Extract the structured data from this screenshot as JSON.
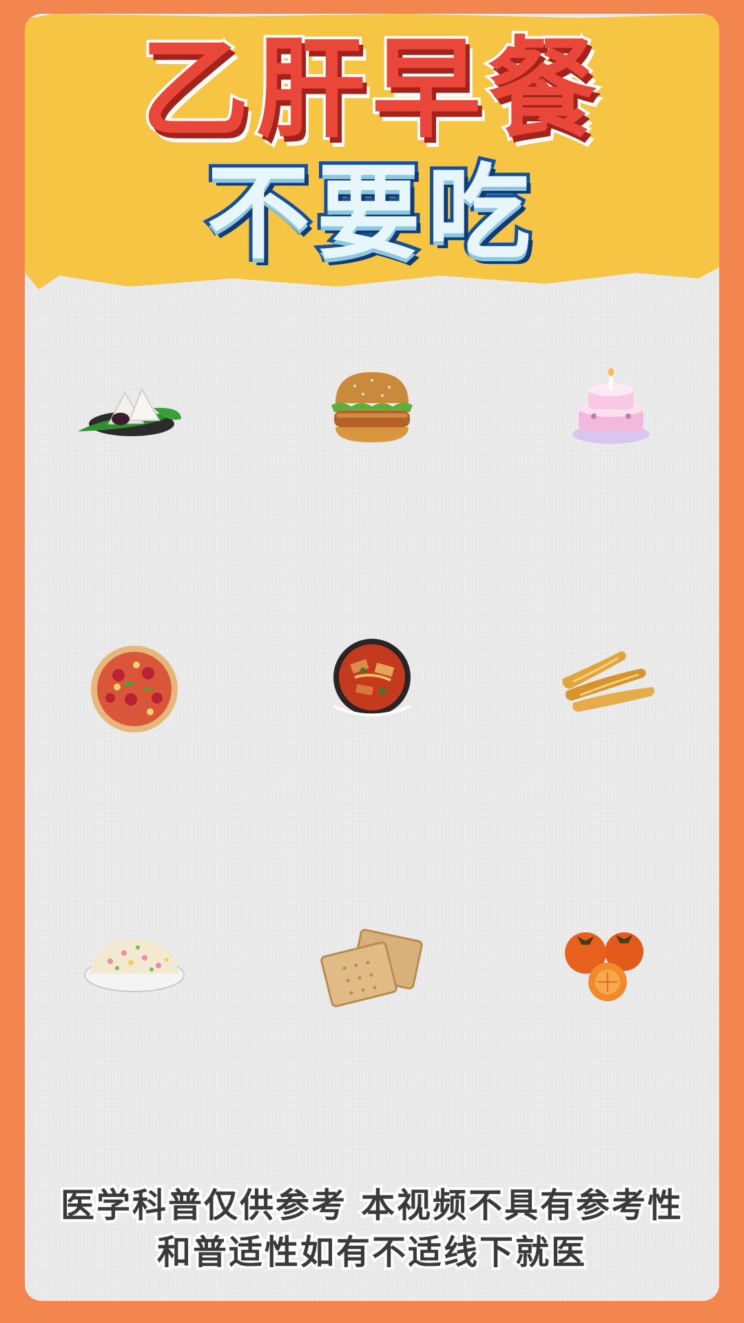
{
  "title": {
    "line1": "乙肝早餐",
    "line2": "不要吃"
  },
  "foods": [
    {
      "icon": "zongzi-icon"
    },
    {
      "icon": "burger-icon"
    },
    {
      "icon": "cake-icon"
    },
    {
      "icon": "pizza-icon"
    },
    {
      "icon": "spicy-hotpot-icon"
    },
    {
      "icon": "fried-dough-stick-icon"
    },
    {
      "icon": "fried-rice-icon"
    },
    {
      "icon": "biscuit-icon"
    },
    {
      "icon": "persimmon-icon"
    }
  ],
  "disclaimer": {
    "line1": "医学科普仅供参考 本视频不具有参考性",
    "line2": "和普适性如有不适线下就医"
  },
  "colors": {
    "border": "#f2864e",
    "banner": "#f6c544",
    "title_red": "#e8473a",
    "title_blue": "#16509a"
  }
}
